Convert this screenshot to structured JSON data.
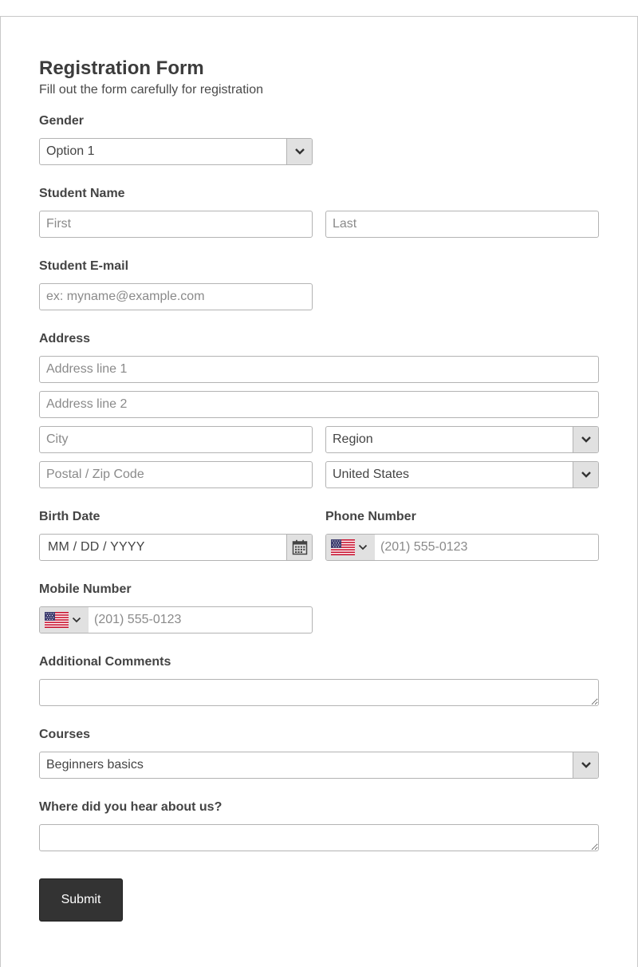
{
  "form": {
    "title": "Registration Form",
    "subtitle": "Fill out the form carefully for registration"
  },
  "gender": {
    "label": "Gender",
    "value": "Option 1"
  },
  "student_name": {
    "label": "Student Name",
    "first_placeholder": "First",
    "last_placeholder": "Last"
  },
  "email": {
    "label": "Student E-mail",
    "placeholder": "ex: myname@example.com"
  },
  "address": {
    "label": "Address",
    "line1_placeholder": "Address line 1",
    "line2_placeholder": "Address line 2",
    "city_placeholder": "City",
    "region_value": "Region",
    "postal_placeholder": "Postal / Zip Code",
    "country_value": "United States"
  },
  "birth_date": {
    "label": "Birth Date",
    "placeholder": "MM / DD / YYYY"
  },
  "phone": {
    "label": "Phone Number",
    "placeholder": "(201) 555-0123",
    "flag": "us-flag-icon"
  },
  "mobile": {
    "label": "Mobile Number",
    "placeholder": "(201) 555-0123",
    "flag": "us-flag-icon"
  },
  "comments": {
    "label": "Additional Comments"
  },
  "courses": {
    "label": "Courses",
    "value": "Beginners basics"
  },
  "hear_about": {
    "label": "Where did you hear about us?"
  },
  "submit": {
    "label": "Submit"
  },
  "colors": {
    "button_bg": "#333333",
    "field_border": "#b3b3b3",
    "select_btn_bg": "#e1e1e1"
  }
}
